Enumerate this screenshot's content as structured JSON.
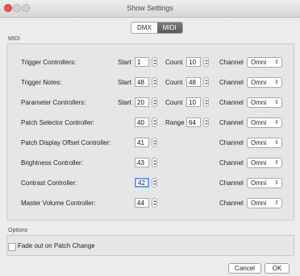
{
  "window": {
    "title": "Show Settings"
  },
  "tabs": [
    {
      "label": "DMX",
      "active": false
    },
    {
      "label": "MIDI",
      "active": true
    }
  ],
  "midi": {
    "group_label": "MIDI",
    "start_label": "Start",
    "count_label": "Count",
    "range_label": "Range",
    "channel_label": "Channel",
    "rows": [
      {
        "label": "Trigger Controllers:",
        "start": "1",
        "count": "10",
        "channel": "Omni"
      },
      {
        "label": "Trigger Notes:",
        "start": "48",
        "count": "48",
        "channel": "Omni"
      },
      {
        "label": "Parameter Controllers:",
        "start": "20",
        "count": "10",
        "channel": "Omni"
      },
      {
        "label": "Patch Selector Controller:",
        "value": "40",
        "range": "64",
        "channel": "Omni"
      },
      {
        "label": "Patch Display Offset Controller:",
        "value": "41",
        "channel": "Omni"
      },
      {
        "label": "Brightness Controller:",
        "value": "43",
        "channel": "Omni"
      },
      {
        "label": "Contrast Controller:",
        "value": "42",
        "channel": "Omni"
      },
      {
        "label": "Master Volume Controller:",
        "value": "44",
        "channel": "Omni"
      }
    ]
  },
  "options": {
    "group_label": "Options",
    "fade_label": "Fade out on Patch Change",
    "fade_checked": false
  },
  "buttons": {
    "cancel": "Cancel",
    "ok": "OK"
  }
}
